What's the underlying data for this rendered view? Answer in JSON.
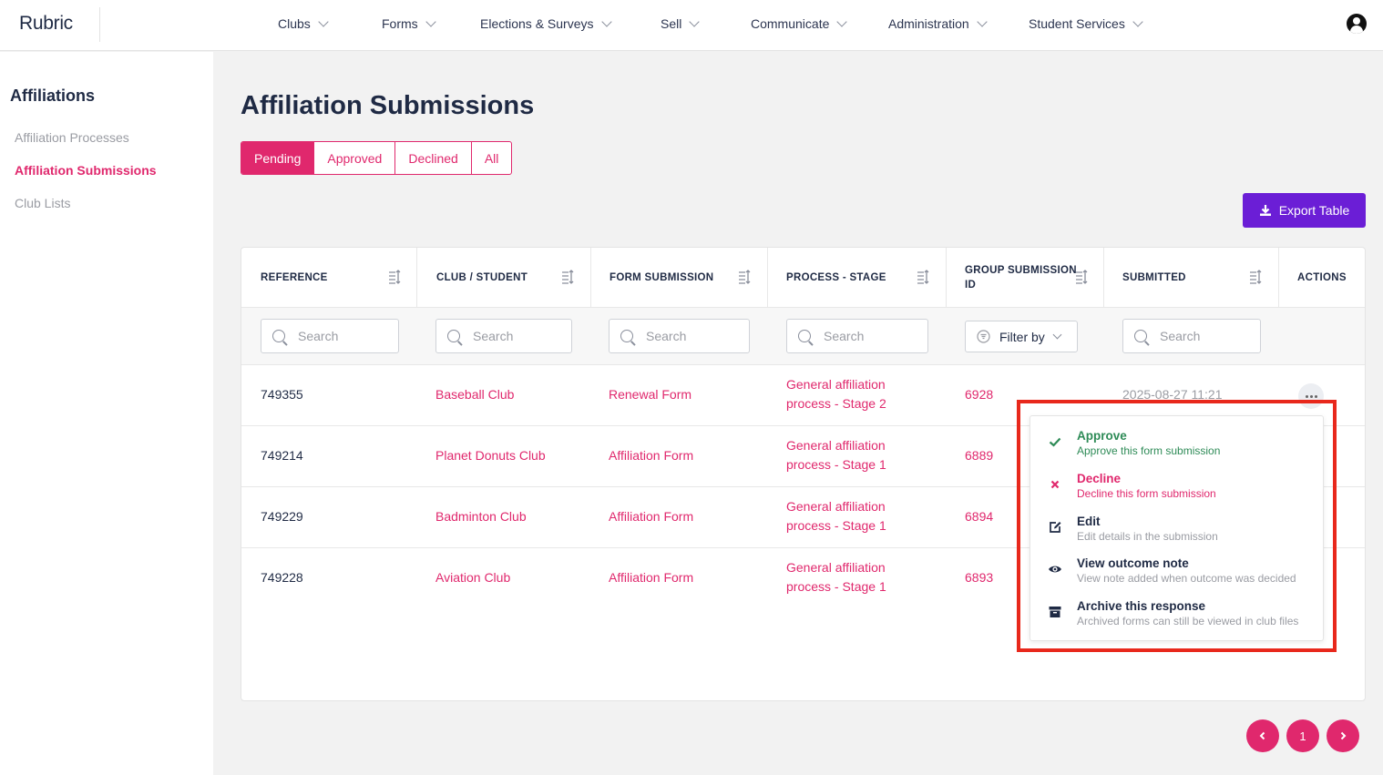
{
  "app": {
    "logo": "Rubric"
  },
  "nav": {
    "items": [
      {
        "label": "Clubs"
      },
      {
        "label": "Forms"
      },
      {
        "label": "Elections & Surveys"
      },
      {
        "label": "Sell"
      },
      {
        "label": "Communicate"
      },
      {
        "label": "Administration"
      },
      {
        "label": "Student Services"
      }
    ]
  },
  "sidebar": {
    "title": "Affiliations",
    "items": [
      {
        "label": "Affiliation Processes",
        "active": false
      },
      {
        "label": "Affiliation Submissions",
        "active": true
      },
      {
        "label": "Club Lists",
        "active": false
      }
    ]
  },
  "main": {
    "title": "Affiliation Submissions",
    "tabs": [
      {
        "label": "Pending",
        "active": true
      },
      {
        "label": "Approved",
        "active": false
      },
      {
        "label": "Declined",
        "active": false
      },
      {
        "label": "All",
        "active": false
      }
    ],
    "export_label": "Export Table"
  },
  "table": {
    "columns": [
      {
        "label": "REFERENCE"
      },
      {
        "label": "CLUB / STUDENT"
      },
      {
        "label": "FORM SUBMISSION"
      },
      {
        "label": "PROCESS - STAGE"
      },
      {
        "label": "GROUP SUBMISSION ID"
      },
      {
        "label": "SUBMITTED"
      },
      {
        "label": "ACTIONS"
      }
    ],
    "filters": {
      "search_placeholder": "Search",
      "filter_by_label": "Filter by"
    },
    "rows": [
      {
        "reference": "749355",
        "club": "Baseball Club",
        "form": "Renewal Form",
        "process_line1": "General affiliation",
        "process_line2": "process - Stage 2",
        "group_id": "6928",
        "submitted": "2025-08-27 11:21"
      },
      {
        "reference": "749214",
        "club": "Planet Donuts Club",
        "form": "Affiliation Form",
        "process_line1": "General affiliation",
        "process_line2": "process - Stage 1",
        "group_id": "6889"
      },
      {
        "reference": "749229",
        "club": "Badminton Club",
        "form": "Affiliation Form",
        "process_line1": "General affiliation",
        "process_line2": "process - Stage 1",
        "group_id": "6894"
      },
      {
        "reference": "749228",
        "club": "Aviation Club",
        "form": "Affiliation Form",
        "process_line1": "General affiliation",
        "process_line2": "process - Stage 1",
        "group_id": "6893"
      }
    ]
  },
  "actions_menu": {
    "items": [
      {
        "title": "Approve",
        "desc": "Approve this form submission",
        "icon": "check-icon",
        "color": "#2e8b57"
      },
      {
        "title": "Decline",
        "desc": "Decline this form submission",
        "icon": "x-icon",
        "color": "#e0286d"
      },
      {
        "title": "Edit",
        "desc": "Edit details in the submission",
        "icon": "edit-icon",
        "color": "#1f2a44"
      },
      {
        "title": "View outcome note",
        "desc": "View note added when outcome was decided",
        "icon": "eye-icon",
        "color": "#1f2a44"
      },
      {
        "title": "Archive this response",
        "desc": "Archived forms can still be viewed in club files",
        "icon": "archive-icon",
        "color": "#1f2a44"
      }
    ]
  },
  "pagination": {
    "current": "1"
  },
  "colors": {
    "accent": "#e0286d",
    "export": "#6b1ed6",
    "highlight": "#e8281c"
  }
}
